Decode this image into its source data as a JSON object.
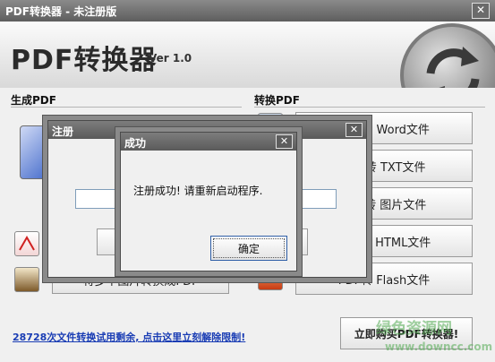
{
  "window": {
    "title": "PDF转换器 - 未注册版",
    "close": "✕"
  },
  "banner": {
    "name": "PDF转换器",
    "version": "Ver 1.0"
  },
  "left": {
    "heading": "生成PDF",
    "buttons": [
      "将多个图片转换成PDF"
    ]
  },
  "right": {
    "heading": "转换PDF",
    "buttons": [
      "PDF转 Word文件",
      "PDF转 TXT文件",
      "PDF转 图片文件",
      "PDF转 HTML文件",
      "PDF转 Flash文件"
    ]
  },
  "register_dialog": {
    "title": "注册",
    "close": "✕"
  },
  "success_dialog": {
    "title": "成功",
    "close": "✕",
    "message": "注册成功! 请重新启动程序.",
    "ok": "确定"
  },
  "footer": {
    "trial_link": "28728次文件转换试用剩余, 点击这里立刻解除限制!",
    "buy_button": "立即购买PDF转换器!"
  },
  "watermark": {
    "line1": "绿色资源网",
    "line2": "www.downcc.com"
  }
}
